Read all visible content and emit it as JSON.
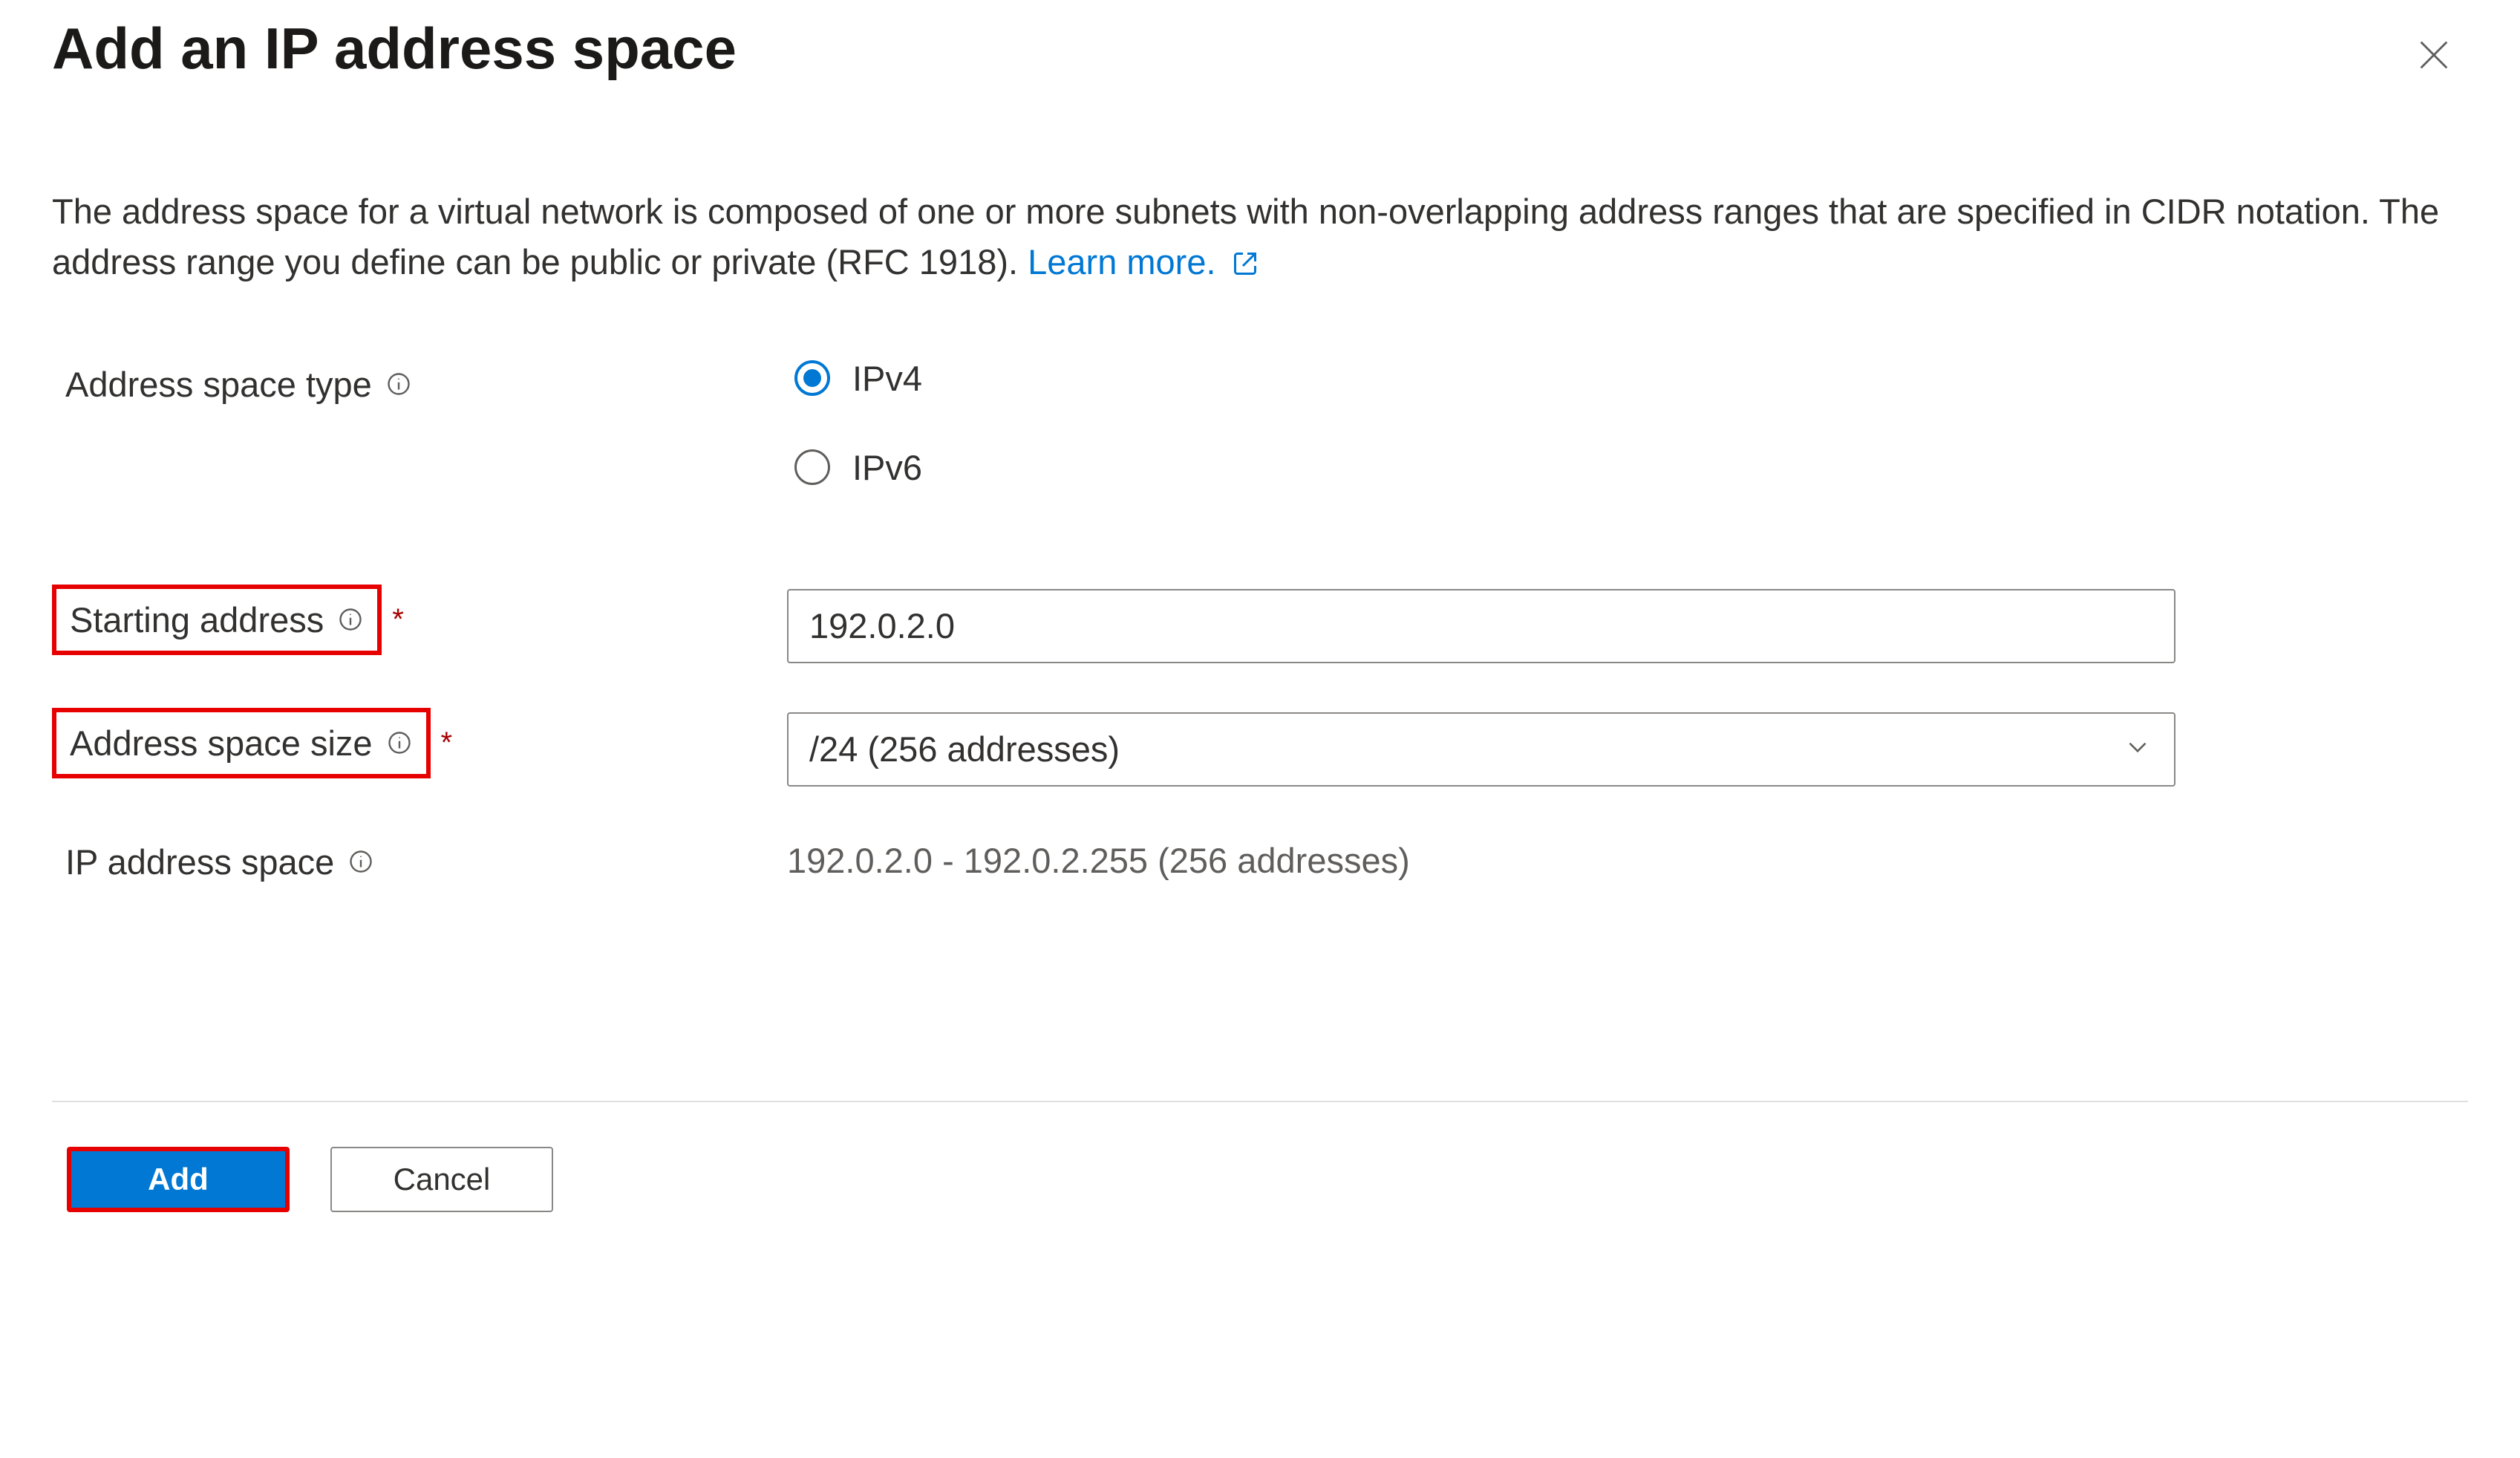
{
  "header": {
    "title": "Add an IP address space"
  },
  "description": {
    "text": "The address space for a virtual network is composed of one or more subnets with non-overlapping address ranges that are specified in CIDR notation. The address range you define can be public or private (RFC 1918). ",
    "learn_more_label": "Learn more."
  },
  "form": {
    "address_space_type": {
      "label": "Address space type",
      "options": {
        "ipv4": "IPv4",
        "ipv6": "IPv6"
      },
      "selected": "ipv4"
    },
    "starting_address": {
      "label": "Starting address",
      "value": "192.0.2.0"
    },
    "address_space_size": {
      "label": "Address space size",
      "value": "/24 (256 addresses)"
    },
    "ip_address_space": {
      "label": "IP address space",
      "value": "192.0.2.0 - 192.0.2.255 (256 addresses)"
    }
  },
  "footer": {
    "add_label": "Add",
    "cancel_label": "Cancel"
  }
}
